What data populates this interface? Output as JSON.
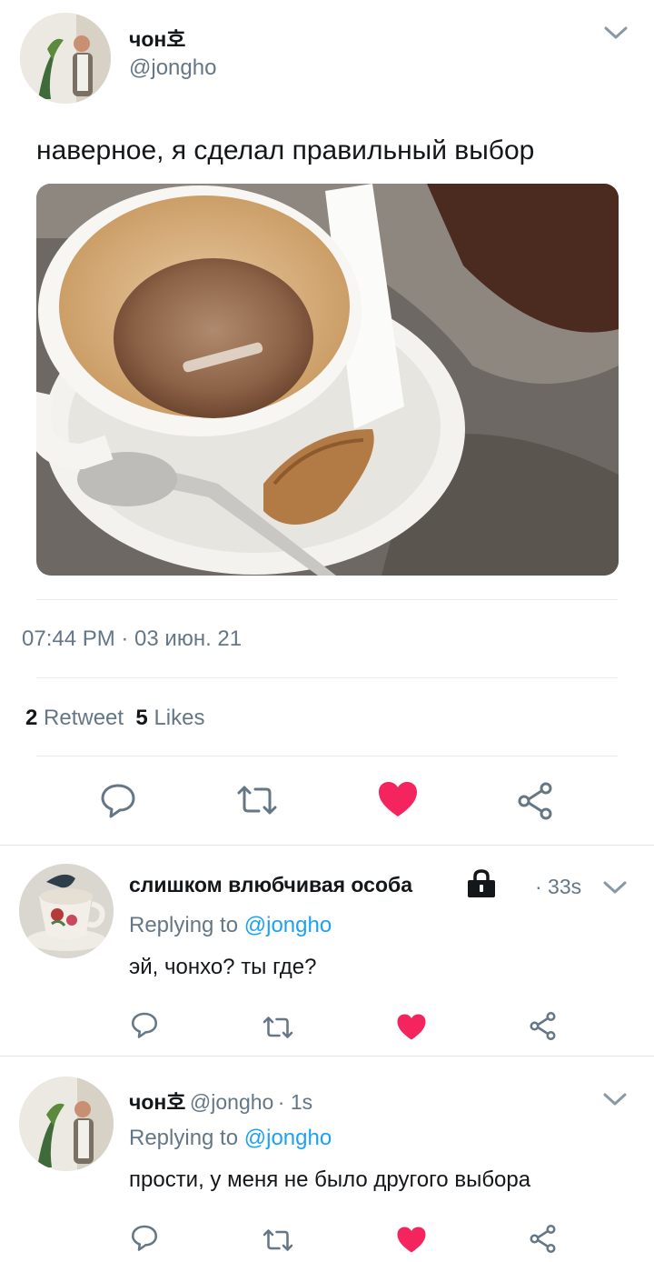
{
  "main_tweet": {
    "author_name": "чон호",
    "author_handle": "@jongho",
    "text": "наверное, я сделал правильный выбор",
    "timestamp": "07:44 PM · 03 июн. 21",
    "retweet_count": "2",
    "retweet_label": "Retweet",
    "likes_count": "5",
    "likes_label": "Likes",
    "liked": true
  },
  "replies": [
    {
      "author_name": "слишком влюбчивая особа",
      "time": "· 33s",
      "replying_label": "Replying to",
      "replying_to": "@jongho",
      "text": "эй, чонхо? ты где?",
      "liked": true
    },
    {
      "author_name": "чон호",
      "author_handle": "@jongho",
      "time": "· 1s",
      "replying_label": "Replying to",
      "replying_to": "@jongho",
      "text": "прости, у меня не было другого выбора",
      "liked": true
    }
  ],
  "colors": {
    "like": "#f4245e",
    "link": "#1da1f2",
    "muted": "#657786",
    "icon": "#657786"
  },
  "icons": [
    "chevron-down-icon",
    "reply-icon",
    "retweet-icon",
    "heart-icon",
    "share-icon",
    "lock-icon"
  ]
}
